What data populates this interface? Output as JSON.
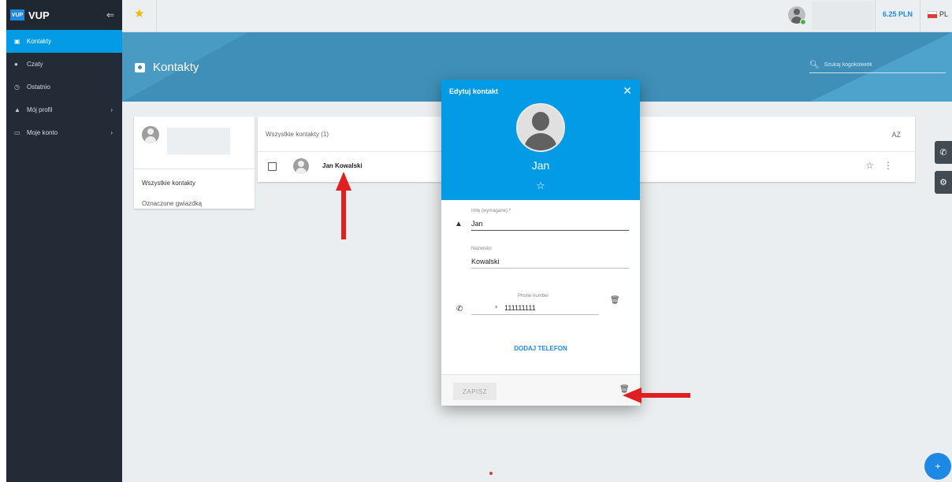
{
  "sidebar": {
    "logo_text": "VUP",
    "brand": "VUP",
    "collapse_icon": "⇐",
    "items": [
      {
        "label": "Kontakty",
        "icon": "contacts-icon",
        "active": true
      },
      {
        "label": "Czaty",
        "icon": "chat-icon"
      },
      {
        "label": "Ostatnio",
        "icon": "clock-icon"
      },
      {
        "label": "Mój profil",
        "icon": "person-icon",
        "chevron": true
      },
      {
        "label": "Moje konto",
        "icon": "card-icon",
        "chevron": true
      }
    ]
  },
  "topbar": {
    "balance": "6.25 PLN",
    "language": "PL"
  },
  "header": {
    "title": "Kontakty",
    "search_placeholder": "Szukaj kogokolwiek"
  },
  "filters": {
    "all": "Wszystkie kontakty",
    "starred": "Oznaczone gwiazdką"
  },
  "list": {
    "header": "Wszystkie kontakty (1)",
    "sort_label": "AZ",
    "rows": [
      {
        "name": "Jan Kowalski"
      }
    ]
  },
  "dialog": {
    "title": "Edytuj kontakt",
    "name": "Jan",
    "first_name_label": "Imię (wymagane)",
    "required_mark": "*",
    "first_name_value": "Jan",
    "last_name_label": "Nazwisko",
    "last_name_value": "Kowalski",
    "phone_label": "Phone number",
    "phone_value": "111111111",
    "add_phone": "DODAJ TELEFON",
    "save": "ZAPISZ"
  },
  "colors": {
    "accent": "#039be5",
    "sidebar": "#222b36",
    "header": "#3f8fb8",
    "arrow": "#e02020"
  }
}
